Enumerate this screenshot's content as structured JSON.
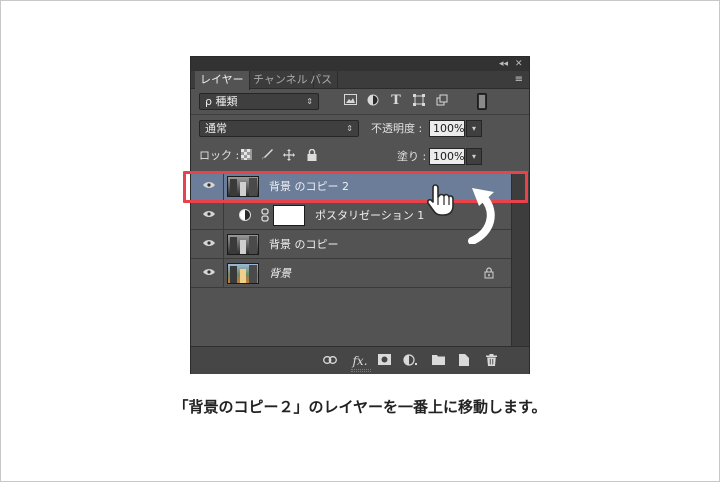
{
  "panel": {
    "controls": {
      "collapse": "◂◂",
      "close": "✕"
    },
    "tabs": [
      "レイヤー",
      "チャンネル",
      "パス"
    ],
    "menu_icon": "≡",
    "filter": {
      "label": "ρ 種類",
      "arrow": "⇕"
    },
    "filter_icons": [
      "image-filter-icon",
      "adjustment-filter-icon",
      "type-filter-icon",
      "shape-filter-icon",
      "smart-object-filter-icon"
    ],
    "blend": {
      "mode": "通常",
      "arrow": "⇕"
    },
    "opacity": {
      "label": "不透明度 :",
      "value": "100%"
    },
    "lock": {
      "label": "ロック :"
    },
    "fill": {
      "label": "塗り :",
      "value": "100%"
    },
    "layers": [
      {
        "name": "背景 のコピー 2",
        "selected": true,
        "type": "bw"
      },
      {
        "name": "ポスタリゼーション 1",
        "selected": false,
        "type": "adjustment"
      },
      {
        "name": "背景 のコピー",
        "selected": false,
        "type": "bw"
      },
      {
        "name": "背景",
        "selected": false,
        "type": "color",
        "locked": true
      }
    ],
    "footer_icons": [
      "link-icon",
      "fx-icon",
      "mask-icon",
      "adjustment-icon",
      "folder-icon",
      "new-layer-icon",
      "trash-icon"
    ]
  },
  "caption": "「背景のコピー２」のレイヤーを一番上に移動します。",
  "colors": {
    "highlight": "#e8424a",
    "selected": "#6b7d98",
    "panel": "#535353"
  }
}
